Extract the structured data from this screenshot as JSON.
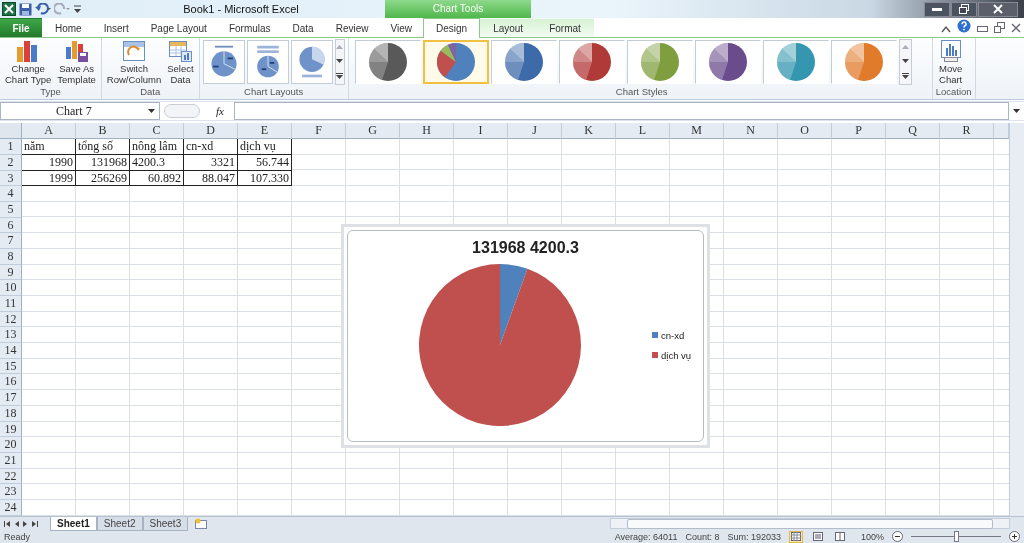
{
  "window": {
    "title": "Book1  -  Microsoft Excel"
  },
  "contextual_group": "Chart Tools",
  "tabs": [
    {
      "label": "File",
      "kind": "file",
      "selected": false
    },
    {
      "label": "Home",
      "kind": "normal",
      "selected": false
    },
    {
      "label": "Insert",
      "kind": "normal",
      "selected": false
    },
    {
      "label": "Page Layout",
      "kind": "normal",
      "selected": false
    },
    {
      "label": "Formulas",
      "kind": "normal",
      "selected": false
    },
    {
      "label": "Data",
      "kind": "normal",
      "selected": false
    },
    {
      "label": "Review",
      "kind": "normal",
      "selected": false
    },
    {
      "label": "View",
      "kind": "normal",
      "selected": false
    },
    {
      "label": "Design",
      "kind": "context",
      "selected": true
    },
    {
      "label": "Layout",
      "kind": "context",
      "selected": false
    },
    {
      "label": "Format",
      "kind": "context",
      "selected": false
    }
  ],
  "ribbon": {
    "groups": [
      {
        "label": "Type",
        "kind": "buttons",
        "buttons": [
          {
            "kind": "chart-type",
            "lines": [
              "Change",
              "Chart Type"
            ]
          },
          {
            "kind": "template",
            "lines": [
              "Save As",
              "Template"
            ]
          }
        ]
      },
      {
        "label": "Data",
        "kind": "buttons",
        "buttons": [
          {
            "kind": "switch",
            "lines": [
              "Switch",
              "Row/Column"
            ]
          },
          {
            "kind": "select",
            "lines": [
              "Select",
              "Data"
            ]
          }
        ]
      },
      {
        "label": "Chart Layouts",
        "kind": "layouts"
      },
      {
        "label": "Chart Styles",
        "kind": "styles",
        "styles": [
          {
            "kind": "mono",
            "color": "#595959",
            "selected": false
          },
          {
            "kind": "multi",
            "color": "#4f81bd",
            "selected": true
          },
          {
            "kind": "mono",
            "color": "#3d6aa8",
            "selected": false
          },
          {
            "kind": "mono",
            "color": "#b03a37",
            "selected": false
          },
          {
            "kind": "mono",
            "color": "#7f9f3f",
            "selected": false
          },
          {
            "kind": "mono",
            "color": "#6a4c8c",
            "selected": false
          },
          {
            "kind": "mono",
            "color": "#3596b0",
            "selected": false
          },
          {
            "kind": "mono",
            "color": "#e07b2c",
            "selected": false
          }
        ]
      },
      {
        "label": "Location",
        "kind": "buttons",
        "buttons": [
          {
            "kind": "move",
            "lines": [
              "Move",
              "Chart"
            ]
          }
        ]
      }
    ]
  },
  "name_box": {
    "value": "Chart 7"
  },
  "function_label": "fx",
  "sheet": {
    "columns": [
      "A",
      "B",
      "C",
      "D",
      "E",
      "F",
      "G",
      "H",
      "I",
      "J",
      "K",
      "L",
      "M",
      "N",
      "O",
      "P",
      "Q",
      "R"
    ],
    "rows": [
      {
        "header": "1",
        "cells": [
          {
            "text": "năm",
            "kind": "text"
          },
          {
            "text": "tổng số",
            "kind": "text"
          },
          {
            "text": "nông lâm",
            "kind": "text"
          },
          {
            "text": "cn-xd",
            "kind": "text"
          },
          {
            "text": "dịch vụ",
            "kind": "text"
          }
        ]
      },
      {
        "header": "2",
        "cells": [
          {
            "text": "1990",
            "kind": "number"
          },
          {
            "text": "131968",
            "kind": "number"
          },
          {
            "text": "4200.3",
            "kind": "text"
          },
          {
            "text": "3321",
            "kind": "number"
          },
          {
            "text": "56.744",
            "kind": "number"
          }
        ]
      },
      {
        "header": "3",
        "cells": [
          {
            "text": "1999",
            "kind": "number"
          },
          {
            "text": "256269",
            "kind": "number"
          },
          {
            "text": "60.892",
            "kind": "number"
          },
          {
            "text": "88.047",
            "kind": "number"
          },
          {
            "text": "107.330",
            "kind": "number"
          }
        ]
      },
      {
        "header": "4"
      },
      {
        "header": "5"
      },
      {
        "header": "6"
      },
      {
        "header": "7"
      },
      {
        "header": "8"
      },
      {
        "header": "9"
      },
      {
        "header": "10"
      },
      {
        "header": "11"
      },
      {
        "header": "12"
      },
      {
        "header": "13"
      },
      {
        "header": "14"
      },
      {
        "header": "15"
      },
      {
        "header": "16"
      },
      {
        "header": "17"
      },
      {
        "header": "18"
      },
      {
        "header": "19"
      },
      {
        "header": "20"
      },
      {
        "header": "21"
      },
      {
        "header": "22"
      },
      {
        "header": "23"
      },
      {
        "header": "24"
      }
    ]
  },
  "chart": {
    "slices": [
      {
        "color": "#4f81bd"
      },
      {
        "color": "#c0504d"
      }
    ],
    "chart_data": {
      "type": "pie",
      "title": "131968 4200.3",
      "categories": [
        "cn-xd",
        "dịch vụ"
      ],
      "legend": "right",
      "series": [
        {
          "values": [
            5.5,
            94.5
          ]
        }
      ]
    }
  },
  "sheet_tabs": [
    {
      "label": "Sheet1",
      "selected": true
    },
    {
      "label": "Sheet2",
      "selected": false
    },
    {
      "label": "Sheet3",
      "selected": false
    }
  ],
  "status_bar": {
    "mode": "Ready",
    "average": "Average: 64011",
    "count": "Count: 8",
    "sum": "Sum: 192033",
    "zoom": "100%",
    "views": [
      {
        "selected": true
      },
      {
        "selected": false
      },
      {
        "selected": false
      }
    ],
    "zoom_slider": {
      "level": 0.5
    }
  }
}
